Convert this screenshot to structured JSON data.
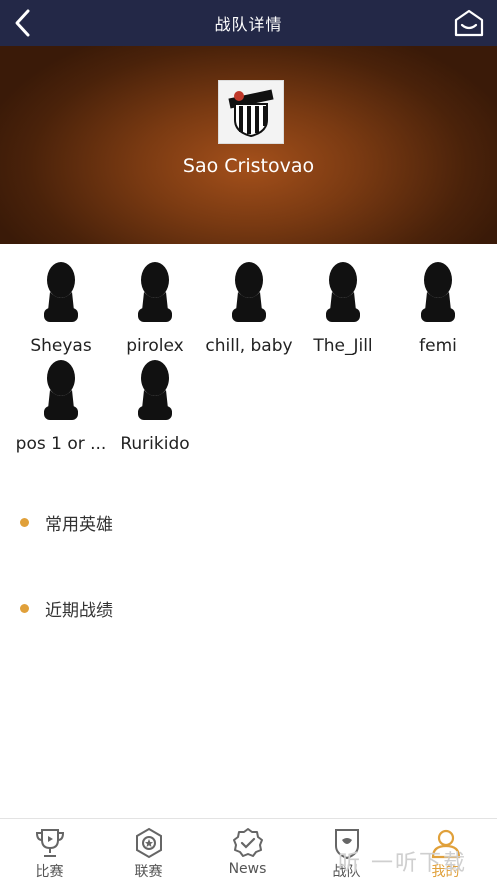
{
  "header": {
    "title": "战队详情",
    "back_icon": "chevron-left-icon",
    "home_icon": "home-icon"
  },
  "team": {
    "name": "Sao Cristovao",
    "logo_icon": "team-crest-icon"
  },
  "players": [
    {
      "name": "Sheyas"
    },
    {
      "name": "pirolex"
    },
    {
      "name": "chill, baby"
    },
    {
      "name": "The_Jill"
    },
    {
      "name": "femi"
    },
    {
      "name": "pos 1 or ..."
    },
    {
      "name": "Rurikido"
    }
  ],
  "sections": {
    "heroes": "常用英雄",
    "recent": "近期战绩"
  },
  "tabs": [
    {
      "label": "比赛",
      "icon": "trophy-icon"
    },
    {
      "label": "联赛",
      "icon": "medal-icon"
    },
    {
      "label": "News",
      "icon": "badge-check-icon"
    },
    {
      "label": "战队",
      "icon": "shield-icon"
    },
    {
      "label": "我的",
      "icon": "user-icon",
      "active": true
    }
  ],
  "watermark": "听 一听下载",
  "colors": {
    "header_bg": "#232847",
    "accent": "#e0a03a",
    "hero_center": "#a4501b"
  }
}
